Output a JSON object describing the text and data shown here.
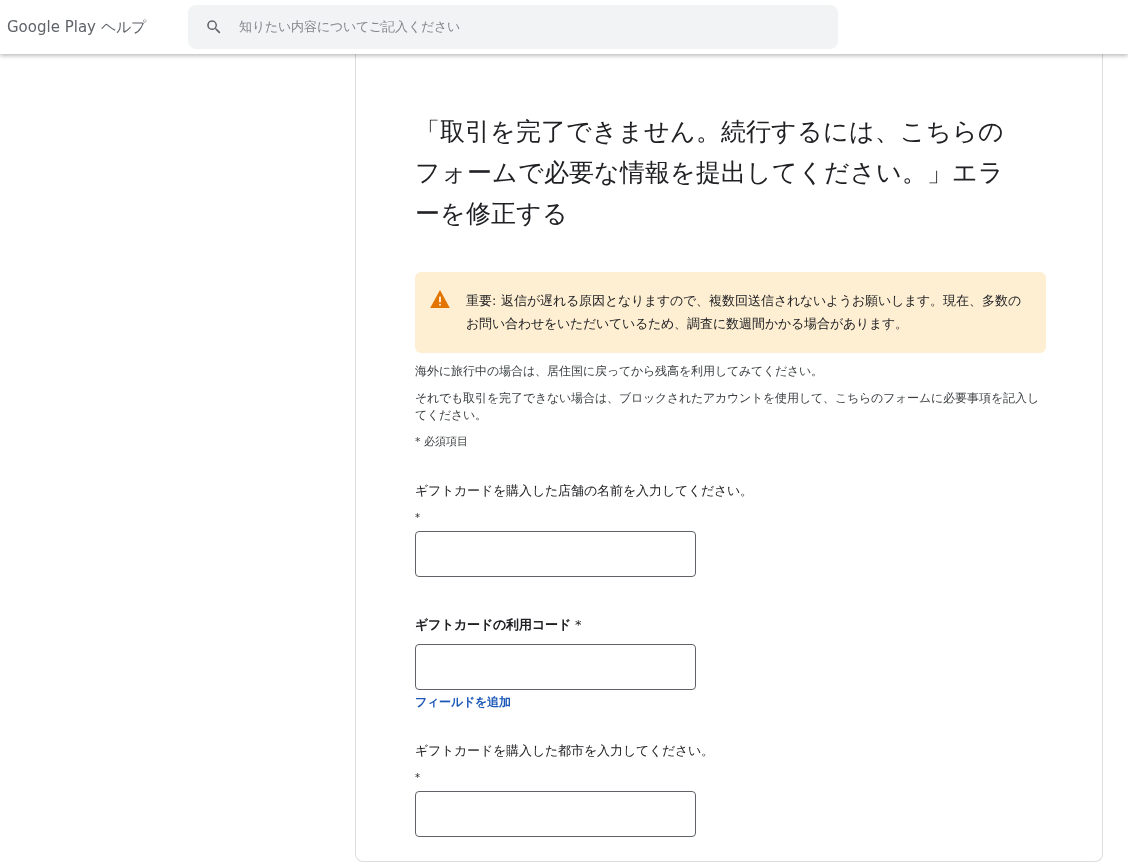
{
  "header": {
    "title": "Google Play ヘルプ",
    "search": {
      "placeholder": "知りたい内容についてご記入ください"
    }
  },
  "article": {
    "title": "「取引を完了できません。続行するには、こちらのフォームで必要な情報を提出してください。」エラーを修正する",
    "notice": "重要: 返信が遅れる原因となりますので、複数回送信されないようお願いします。現在、多数のお問い合わせをいただいているため、調査に数週間かかる場合があります。",
    "paragraphs": [
      "海外に旅行中の場合は、居住国に戻ってから残高を利用してみてください。",
      "それでも取引を完了できない場合は、ブロックされたアカウントを使用して、こちらのフォームに必要事項を記入してください。"
    ],
    "required_note": "* 必須項目",
    "fields": [
      {
        "kind": "long",
        "label": "ギフトカードを購入した店舗の名前を入力してください。",
        "required": "*"
      },
      {
        "kind": "short",
        "label": "ギフトカードの利用コード",
        "required": "*",
        "link": "フィールドを追加"
      },
      {
        "kind": "long",
        "label": "ギフトカードを購入した都市を入力してください。",
        "required": "*"
      }
    ]
  }
}
